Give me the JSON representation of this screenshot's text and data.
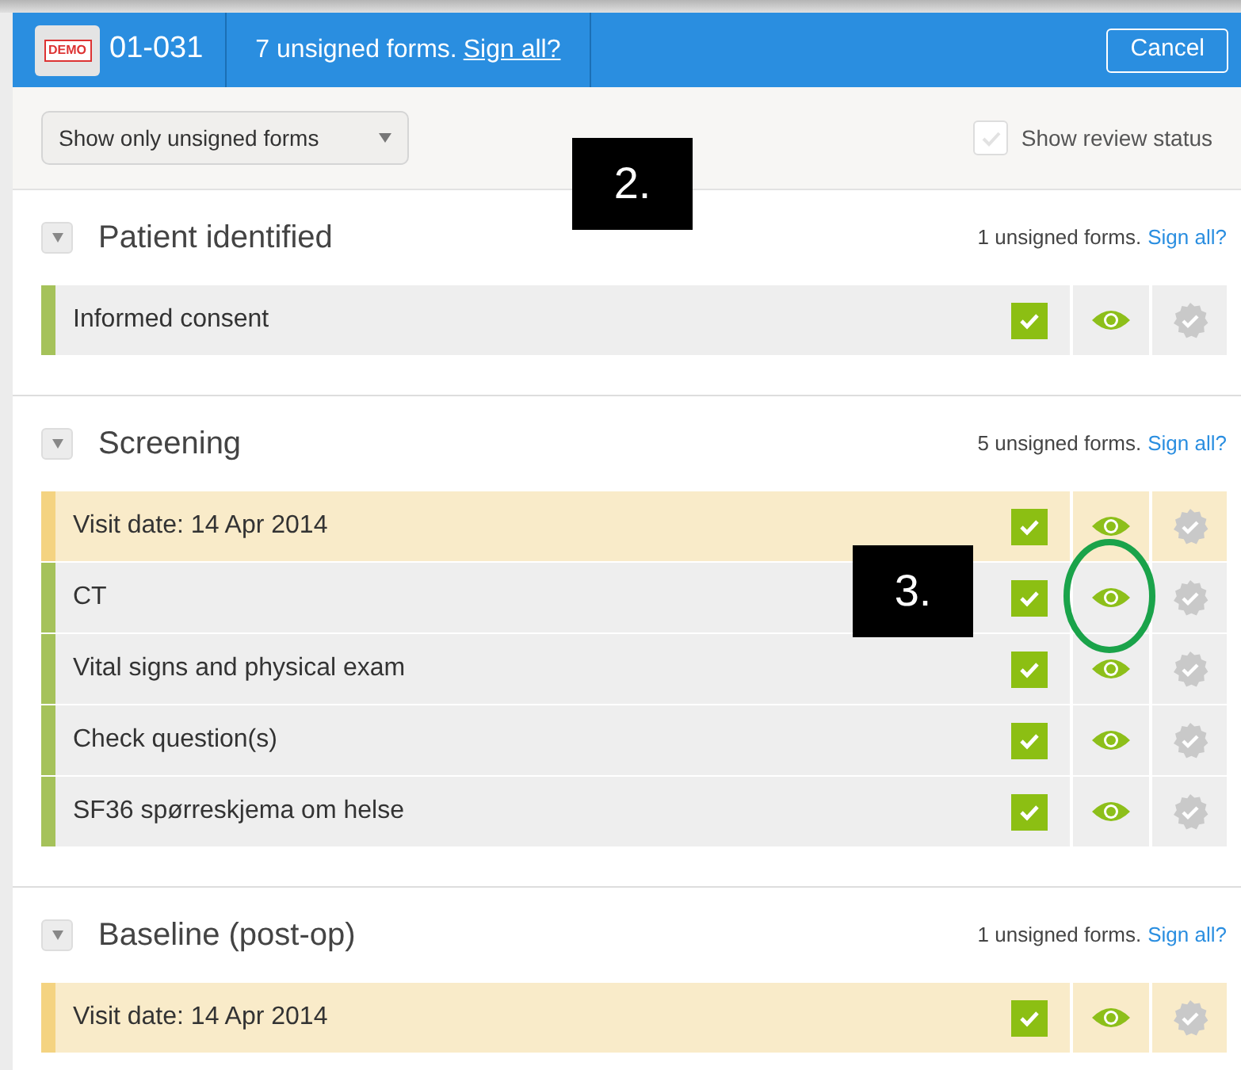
{
  "header": {
    "logo": "DEMO",
    "subject": "01-031",
    "summary": "7 unsigned forms.",
    "sign_all": "Sign all?",
    "cancel": "Cancel"
  },
  "filter": {
    "value": "Show only unsigned forms",
    "review_status": {
      "label": "Show review status",
      "checked": false
    }
  },
  "sections": [
    {
      "title": "Patient identified",
      "summary": "1 unsigned forms.",
      "sign_all": "Sign all?",
      "expanded": true,
      "rows": [
        {
          "label": "Informed consent",
          "kind": "form",
          "checked": true
        }
      ]
    },
    {
      "title": "Screening",
      "summary": "5 unsigned forms.",
      "sign_all": "Sign all?",
      "expanded": true,
      "rows": [
        {
          "label": "Visit date: 14 Apr 2014",
          "kind": "visit",
          "checked": true
        },
        {
          "label": "CT",
          "kind": "form",
          "checked": true
        },
        {
          "label": "Vital signs and physical exam",
          "kind": "form",
          "checked": true
        },
        {
          "label": "Check question(s)",
          "kind": "form",
          "checked": true
        },
        {
          "label": "SF36 spørreskjema om helse",
          "kind": "form",
          "checked": true
        }
      ]
    },
    {
      "title": "Baseline (post-op)",
      "summary": "1 unsigned forms.",
      "sign_all": "Sign all?",
      "expanded": true,
      "rows": [
        {
          "label": "Visit date: 14 Apr 2014",
          "kind": "visit",
          "checked": true
        }
      ]
    }
  ],
  "annotations": [
    {
      "kind": "label",
      "text": "2."
    },
    {
      "kind": "label",
      "text": "3."
    },
    {
      "kind": "circle"
    }
  ]
}
